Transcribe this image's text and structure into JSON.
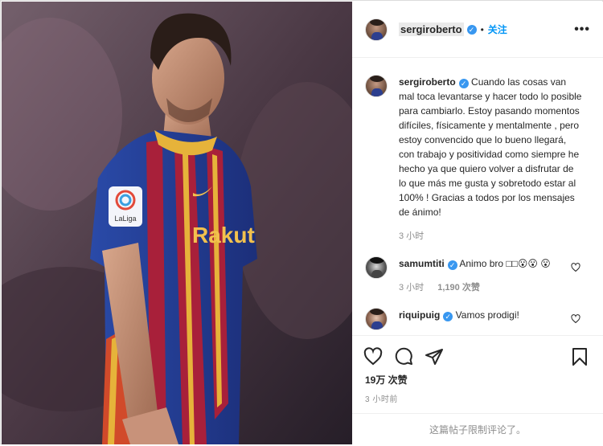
{
  "header": {
    "username": "sergiroberto",
    "follow_label": "关注",
    "dot": "•",
    "more": "•••"
  },
  "caption": {
    "username": "sergiroberto",
    "text": "Cuando las cosas van mal toca levantarse y hacer todo lo posible para cambiarlo. Estoy pasando momentos difíciles, físicamente y mentalmente , pero estoy convencido que lo bueno llegará, con trabajo y positividad como siempre he hecho ya que quiero volver a disfrutar de lo que más me gusta y sobretodo estar al 100% ! Gracias a todos por los mensajes de ánimo!",
    "time": "3 小时"
  },
  "comments": [
    {
      "username": "samumtiti",
      "text": "Animo bro □□😮😮 😮",
      "time": "3 小时",
      "likes": "1,190 次赞"
    },
    {
      "username": "riquipuig",
      "text": "Vamos prodigi!"
    }
  ],
  "post": {
    "likes": "19万 次赞",
    "time": "3 小时前",
    "comments_limited": "这篇帖子限制评论了。"
  },
  "photo": {
    "jersey_sponsor": "Rakut",
    "patch_text": "LaLiga"
  },
  "colors": {
    "accent": "#0095f6",
    "verified": "#3897f0",
    "muted": "#8e8e8e",
    "text": "#262626"
  },
  "icons": [
    "verified-icon",
    "heart-icon",
    "comment-icon",
    "share-icon",
    "bookmark-icon",
    "more-icon"
  ]
}
